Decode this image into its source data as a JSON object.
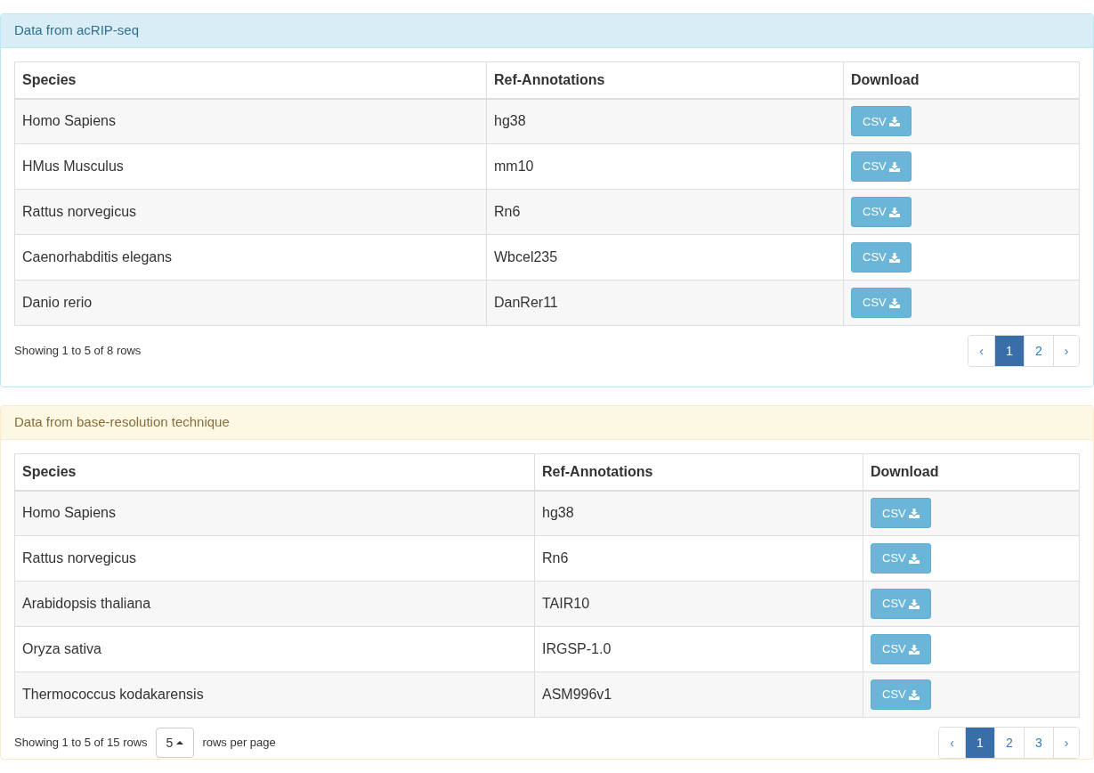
{
  "panels": [
    {
      "kind": "info",
      "title": "Data from acRIP-seq",
      "columns": [
        "Species",
        "Ref-Annotations",
        "Download"
      ],
      "rows": [
        {
          "species": "Homo Sapiens",
          "annotation": "hg38",
          "download": "CSV"
        },
        {
          "species": "HMus Musculus",
          "annotation": "mm10",
          "download": "CSV"
        },
        {
          "species": "Rattus norvegicus",
          "annotation": "Rn6",
          "download": "CSV"
        },
        {
          "species": "Caenorhabditis elegans",
          "annotation": "Wbcel235",
          "download": "CSV"
        },
        {
          "species": "Danio rerio",
          "annotation": "DanRer11",
          "download": "CSV"
        }
      ],
      "summary": "Showing 1 to 5 of 8 rows",
      "pagination": [
        {
          "label": "‹",
          "selected": false
        },
        {
          "label": "1",
          "selected": true
        },
        {
          "label": "2",
          "selected": false
        },
        {
          "label": "›",
          "selected": false
        }
      ]
    },
    {
      "kind": "warning",
      "title": "Data from base-resolution technique",
      "columns": [
        "Species",
        "Ref-Annotations",
        "Download"
      ],
      "rows": [
        {
          "species": "Homo Sapiens",
          "annotation": "hg38",
          "download": "CSV"
        },
        {
          "species": "Rattus norvegicus",
          "annotation": "Rn6",
          "download": "CSV"
        },
        {
          "species": "Arabidopsis thaliana",
          "annotation": "TAIR10",
          "download": "CSV"
        },
        {
          "species": "Oryza sativa",
          "annotation": "IRGSP-1.0",
          "download": "CSV"
        },
        {
          "species": "Thermococcus kodakarensis",
          "annotation": "ASM996v1",
          "download": "CSV"
        }
      ],
      "summary": "Showing 1 to 5 of 15 rows",
      "page_size": {
        "value": "5",
        "suffix": "rows per page"
      },
      "pagination": [
        {
          "label": "‹",
          "selected": false
        },
        {
          "label": "1",
          "selected": true
        },
        {
          "label": "2",
          "selected": false
        },
        {
          "label": "3",
          "selected": false
        },
        {
          "label": "›",
          "selected": false
        }
      ]
    }
  ]
}
